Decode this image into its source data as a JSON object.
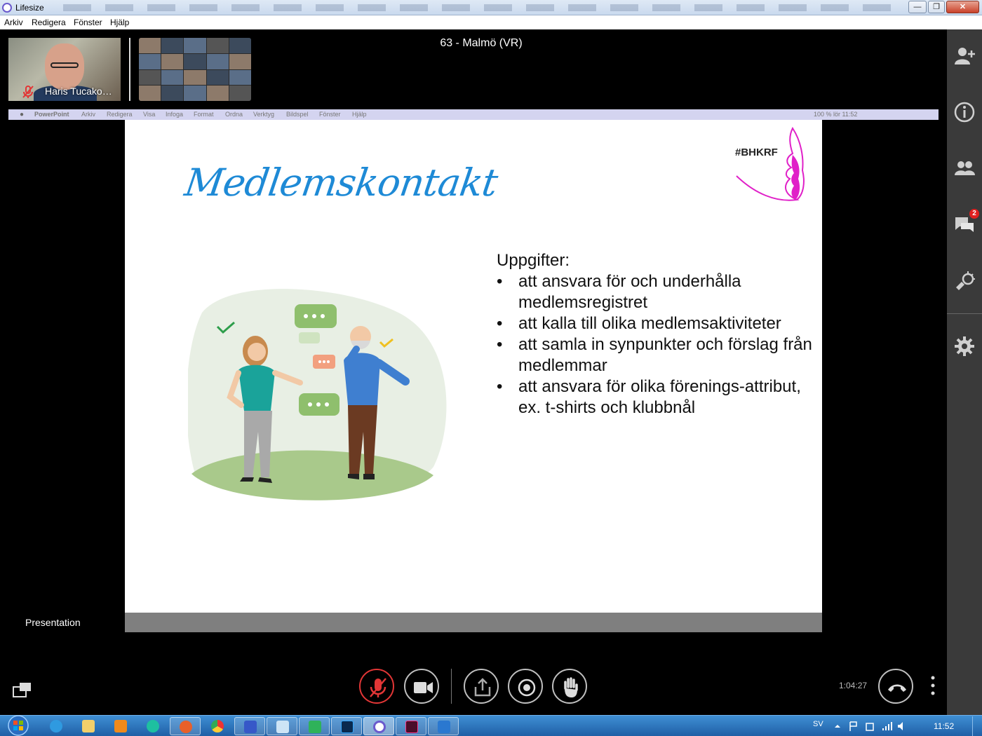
{
  "window": {
    "title": "Lifesize",
    "minimize_label": "—",
    "maximize_label": "❐",
    "close_label": "✕"
  },
  "menubar": [
    "Arkiv",
    "Redigera",
    "Fönster",
    "Hjälp"
  ],
  "meeting": {
    "title": "63 - Malmö (VR)",
    "self_view_name": "Haris Tucako…",
    "view_label": "Presentation",
    "elapsed": "1:04:27"
  },
  "shared_screen": {
    "mac_menu": [
      "PowerPoint",
      "Arkiv",
      "Redigera",
      "Visa",
      "Infoga",
      "Format",
      "Ordna",
      "Verktyg",
      "Bildspel",
      "Fönster",
      "Hjälp"
    ],
    "mac_status": "100 %  lör 11:52",
    "slide": {
      "title": "Medlemskontakt",
      "hashtag": "#BHKRF",
      "heading": "Uppgifter:",
      "bullets": [
        "att ansvara för och underhålla medlemsregistret",
        "att kalla till olika medlemsaktiviteter",
        "att samla in synpunkter och förslag från medlemmar",
        "att ansvara för olika förenings-attribut, ex. t-shirts och klubbnål"
      ]
    }
  },
  "sidebar": {
    "icons": [
      "add-participant-icon",
      "info-icon",
      "participants-icon",
      "chat-icon",
      "presentation-tools-icon",
      "settings-icon"
    ],
    "chat_badge": "2"
  },
  "controls": [
    "microphone-muted-icon",
    "camera-icon",
    "share-icon",
    "record-icon",
    "raise-hand-icon",
    "hang-up-icon",
    "more-options-icon"
  ],
  "taskbar": {
    "language": "SV",
    "clock": "11:52"
  },
  "colors": {
    "accent_blue": "#1e8ad6",
    "brand_pink": "#e020c8",
    "muted_red": "#e23636"
  }
}
